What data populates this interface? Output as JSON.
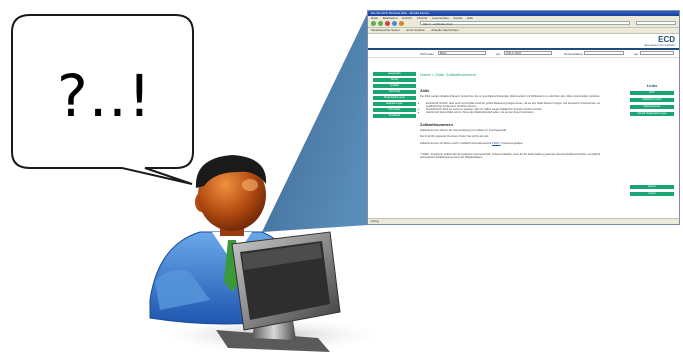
{
  "bubble": {
    "text": "?..!"
  },
  "browser": {
    "title": "EU-Tax ECD Mozaica Web - Mozilla Firefox",
    "menu": [
      "Datei",
      "Bearbeiten",
      "Ansicht",
      "Chronik",
      "Lesezeichen",
      "Extras",
      "Hilfe"
    ],
    "url": "http://...ecd/index.html",
    "bookmarks": [
      "Meistbesuchte Seiten",
      "Erste Schritte",
      "Aktuelle Nachrichten"
    ],
    "logo": {
      "main": "ECD",
      "sub": "European Commission"
    },
    "form": {
      "field1_label": "Tarif-Code",
      "field1_value": "Bulin",
      "field2_label": "per",
      "field2_value": "CW-1-7007",
      "field3_label": "Nomenclature",
      "field4_label": "per"
    },
    "sidebar": [
      "Hauptseite",
      "Suche",
      "Qualität",
      "Sicherheit",
      "Begleitdokumente",
      "Erläuterungen",
      "Formulare",
      "Feedback"
    ],
    "page_heading": "Home > Zölle, Zolltarifnummern",
    "content": {
      "section1_title": "Zölle",
      "section1_intro": "Die Zölle werden Abgaben/Steuern bezeichnet, die im grenzüberschreitenden Warenverkehr mit Drittländern zu entrichten sind. Man unterscheidet zwischen",
      "bullets": [
        "Einfuhrzoll: Einfuhr, aber auch Importzöllen sind die größte Bedeutung beigemessen, da sie den Staat Steuern bringen und heimische Unternehmen vor ausländischer Konkurrenz schützen können.",
        "Durchfuhrzoll: Wird ein Land nur passiert, aber ist zollfrei wegen fiskalischer Gründe erhoben worden.",
        "Ausfuhrzoll: Exportzölle sind im Sinne der Marktwirtschaft selten, da sie den Export behindern."
      ],
      "section2_title": "Zolltarifnummern",
      "section2_p1": "Zolltarifnummern dienen der Harmonisierung von Waren im Importgeschäft.",
      "section2_p2": "Die für ECD relevanten Nummern finden Sie rechts als Link.",
      "section2_p3_prefix": "Zolltarifnummern für Waren sind im Zolltarif-Informationsportal",
      "section2_p3_link": "TARIC*",
      "section2_p3_suffix": "zusammengefasst.",
      "footnote": "* TARIC: Integrierter Zolltarif der Europäischen Gemeinschaft, umfasst Zollsätze sowie für die Zollverwaltung geltende Gemeinschaftsvorschriften, ermöglicht automatische Zolabfertigung durch die Mitgliedstaaten."
    },
    "links": {
      "heading": "Links",
      "items": [
        "EZT",
        "Zolltarifnummern",
        "Warennummer",
        "Aktuell: Zollaussetzungen"
      ],
      "lower_items": [
        "Export",
        "Import"
      ]
    },
    "status": "Fertig"
  },
  "colors": {
    "accent": "#1aa672",
    "wedge": "#35668f",
    "brand": "#1e4d7a"
  },
  "icons": [
    "speech-bubble-icon",
    "person-icon",
    "monitor-icon"
  ]
}
